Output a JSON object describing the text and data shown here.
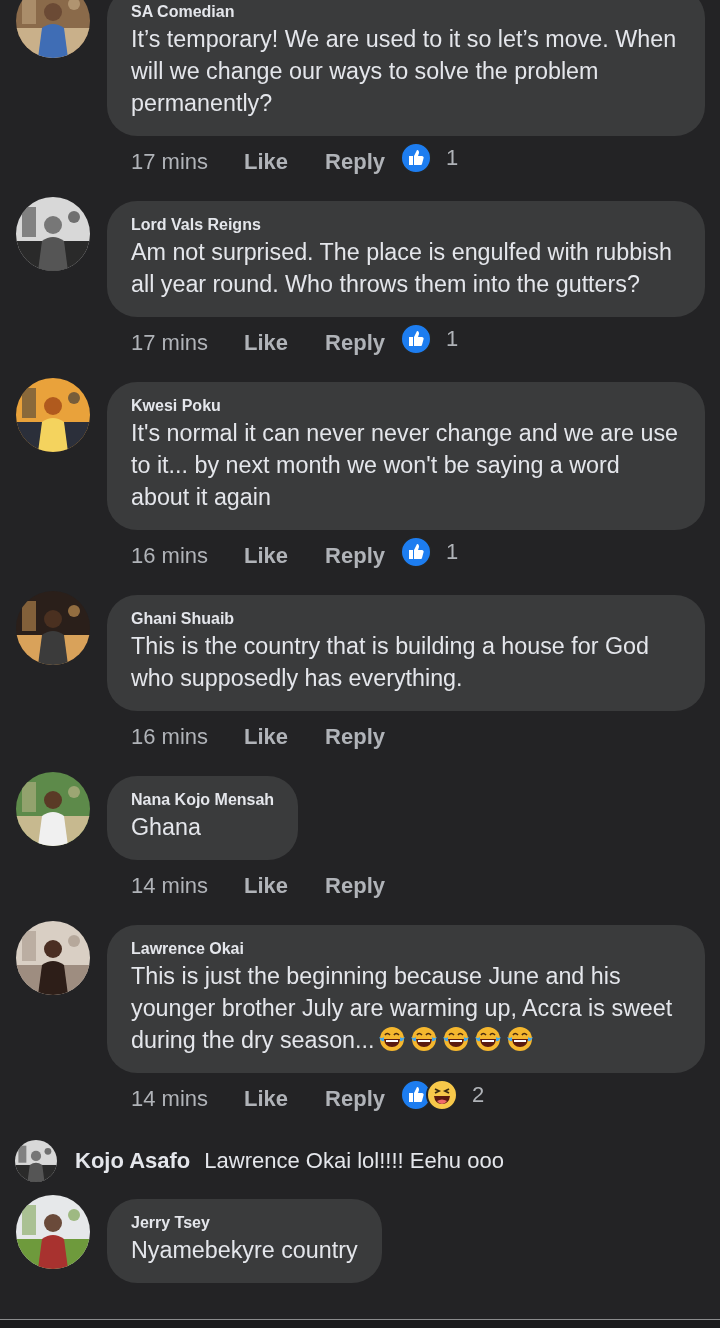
{
  "comments": [
    {
      "author": "SA Comedian",
      "text": "It’s temporary! We are used to it so let’s move. When will we change our ways to solve the problem permanently?",
      "time": "17 mins",
      "like_label": "Like",
      "reply_label": "Reply",
      "reactions": [
        {
          "kind": "like"
        }
      ],
      "reaction_count": "1"
    },
    {
      "author": "Lord Vals Reigns",
      "text": "Am not surprised. The place is engulfed with rubbish all year round. Who throws them into the gutters?",
      "time": "17 mins",
      "like_label": "Like",
      "reply_label": "Reply",
      "reactions": [
        {
          "kind": "like"
        }
      ],
      "reaction_count": "1"
    },
    {
      "author": "Kwesi Poku",
      "text": "It's normal it can never never change and we are use to it... by next month we won't be saying a word about it again",
      "time": "16 mins",
      "like_label": "Like",
      "reply_label": "Reply",
      "reactions": [
        {
          "kind": "like"
        }
      ],
      "reaction_count": "1"
    },
    {
      "author": "Ghani Shuaib",
      "text": "This is the country that is building a house for God who supposedly has everything.",
      "time": "16 mins",
      "like_label": "Like",
      "reply_label": "Reply"
    },
    {
      "author": "Nana Kojo Mensah",
      "text": "Ghana",
      "time": "14 mins",
      "like_label": "Like",
      "reply_label": "Reply"
    },
    {
      "author": "Lawrence Okai",
      "text": "This is just the beginning because June and his younger brother July are warming up, Accra is sweet during the dry season...",
      "emojis": [
        {
          "kind": "laugh_cry"
        },
        {
          "kind": "laugh_cry"
        },
        {
          "kind": "laugh_cry"
        },
        {
          "kind": "laugh_cry"
        },
        {
          "kind": "laugh_cry"
        }
      ],
      "time": "14 mins",
      "like_label": "Like",
      "reply_label": "Reply",
      "reactions": [
        {
          "kind": "like"
        },
        {
          "kind": "haha"
        }
      ],
      "reaction_count": "2",
      "replies": [
        {
          "author": "Kojo Asafo",
          "text": "Lawrence Okai lol!!!! Eehu ooo"
        }
      ]
    },
    {
      "author": "Jerry Tsey",
      "text": "Nyamebekyre country"
    }
  ]
}
